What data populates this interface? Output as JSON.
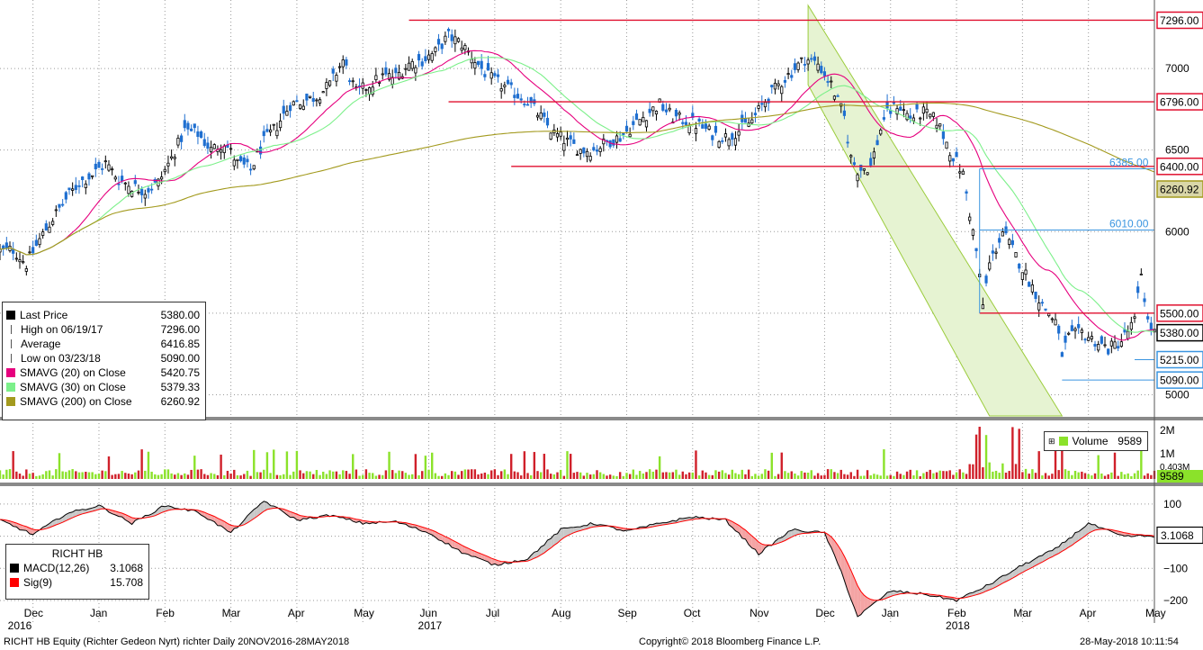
{
  "ticker": "RICHT HB",
  "price_legend": {
    "rows": [
      {
        "label": "Last Price",
        "value": "5380.00",
        "swatch": "#000000"
      },
      {
        "label": "High on 06/19/17",
        "value": "7296.00",
        "swatch": "none"
      },
      {
        "label": "Average",
        "value": "6416.85",
        "swatch": "none"
      },
      {
        "label": "Low on 03/23/18",
        "value": "5090.00",
        "swatch": "none"
      },
      {
        "label": "SMAVG (20) on Close",
        "value": "5420.75",
        "swatch": "#e6007e"
      },
      {
        "label": "SMAVG (30) on Close",
        "value": "5379.33",
        "swatch": "#7cf08a"
      },
      {
        "label": "SMAVG (200) on Close",
        "value": "6260.92",
        "swatch": "#a39a1e"
      }
    ]
  },
  "volume_legend": {
    "label": "Volume",
    "value": "9589"
  },
  "macd_legend": {
    "title": "RICHT HB",
    "rows": [
      {
        "label": "MACD(12,26)",
        "value": "3.1068",
        "swatch": "#000000"
      },
      {
        "label": "Sig(9)",
        "value": "15.708",
        "swatch": "#ff0000"
      }
    ]
  },
  "footer": {
    "left": "RICHT HB Equity (Richter Gedeon Nyrt) richter  Daily 20NOV2016-28MAY2018",
    "center": "Copyright© 2018 Bloomberg Finance L.P.",
    "right": "28-May-2018 10:11:54"
  },
  "colors": {
    "up": "#000000",
    "down": "#1f6fd0",
    "sma20": "#e6007e",
    "sma30": "#7cf08a",
    "sma200": "#a39a1e",
    "level": "#e0102f",
    "fib": "#3a95e0",
    "channel": "#9bcc3c",
    "macd": "#000000",
    "signal": "#ff0000"
  },
  "chart_data": [
    {
      "type": "candlestick",
      "x_months": [
        "Dec",
        "Jan",
        "Feb",
        "Mar",
        "Apr",
        "May",
        "Jun",
        "Jul",
        "Aug",
        "Sep",
        "Oct",
        "Nov",
        "Dec",
        "Jan",
        "Feb",
        "Mar",
        "Apr",
        "May"
      ],
      "years": [
        "2016",
        "2017",
        "2018"
      ],
      "y_ticks": [
        5000,
        5500,
        6000,
        6500,
        7000
      ],
      "ylim": [
        4870,
        7420
      ],
      "close_path": [
        [
          0,
          5880
        ],
        [
          4,
          5890
        ],
        [
          8,
          5800
        ],
        [
          12,
          5950
        ],
        [
          16,
          6080
        ],
        [
          20,
          6200
        ],
        [
          24,
          6300
        ],
        [
          28,
          6350
        ],
        [
          32,
          6420
        ],
        [
          36,
          6320
        ],
        [
          40,
          6280
        ],
        [
          44,
          6250
        ],
        [
          48,
          6300
        ],
        [
          52,
          6450
        ],
        [
          56,
          6620
        ],
        [
          60,
          6600
        ],
        [
          64,
          6500
        ],
        [
          68,
          6550
        ],
        [
          72,
          6420
        ],
        [
          76,
          6380
        ],
        [
          80,
          6550
        ],
        [
          84,
          6650
        ],
        [
          88,
          6780
        ],
        [
          92,
          6800
        ],
        [
          96,
          6830
        ],
        [
          100,
          6900
        ],
        [
          104,
          7050
        ],
        [
          108,
          6850
        ],
        [
          112,
          6900
        ],
        [
          116,
          6950
        ],
        [
          120,
          6950
        ],
        [
          124,
          7030
        ],
        [
          128,
          7050
        ],
        [
          132,
          7100
        ],
        [
          136,
          7200
        ],
        [
          140,
          7150
        ],
        [
          144,
          7050
        ],
        [
          148,
          6950
        ],
        [
          152,
          6900
        ],
        [
          156,
          6850
        ],
        [
          160,
          6800
        ],
        [
          164,
          6700
        ],
        [
          168,
          6600
        ],
        [
          172,
          6550
        ],
        [
          176,
          6500
        ],
        [
          180,
          6500
        ],
        [
          184,
          6550
        ],
        [
          188,
          6580
        ],
        [
          192,
          6650
        ],
        [
          196,
          6720
        ],
        [
          200,
          6780
        ],
        [
          204,
          6700
        ],
        [
          208,
          6680
        ],
        [
          212,
          6650
        ],
        [
          216,
          6600
        ],
        [
          220,
          6580
        ],
        [
          224,
          6620
        ],
        [
          228,
          6680
        ],
        [
          232,
          6800
        ],
        [
          236,
          6900
        ],
        [
          240,
          6980
        ],
        [
          244,
          7060
        ],
        [
          248,
          7030
        ],
        [
          252,
          6900
        ],
        [
          256,
          6700
        ],
        [
          258,
          6450
        ],
        [
          260,
          6380
        ],
        [
          264,
          6400
        ],
        [
          268,
          6700
        ],
        [
          272,
          6780
        ],
        [
          276,
          6700
        ],
        [
          280,
          6730
        ],
        [
          284,
          6680
        ],
        [
          288,
          6500
        ],
        [
          292,
          6350
        ],
        [
          296,
          5880
        ],
        [
          298,
          5550
        ],
        [
          300,
          5800
        ],
        [
          304,
          6000
        ],
        [
          308,
          5850
        ],
        [
          312,
          5700
        ],
        [
          316,
          5550
        ],
        [
          320,
          5450
        ],
        [
          322,
          5250
        ],
        [
          324,
          5350
        ],
        [
          328,
          5380
        ],
        [
          332,
          5330
        ],
        [
          336,
          5280
        ],
        [
          340,
          5330
        ],
        [
          344,
          5450
        ],
        [
          346,
          5750
        ],
        [
          348,
          5450
        ],
        [
          350,
          5380
        ]
      ],
      "series": [
        {
          "name": "SMAVG (20) on Close",
          "last": 5420.75
        },
        {
          "name": "SMAVG (30) on Close",
          "last": 5379.33
        },
        {
          "name": "SMAVG (200) on Close",
          "last": 6260.92
        }
      ],
      "price_labels": [
        {
          "text": "7296.00",
          "value": 7296,
          "kind": "level"
        },
        {
          "text": "6796.00",
          "value": 6796,
          "kind": "level"
        },
        {
          "text": "6400.00",
          "value": 6400,
          "kind": "level"
        },
        {
          "text": "6260.92",
          "value": 6260.92,
          "kind": "sma200"
        },
        {
          "text": "5500.00",
          "value": 5500,
          "kind": "level"
        },
        {
          "text": "5380.00",
          "value": 5380,
          "kind": "last"
        },
        {
          "text": "5215.00",
          "value": 5215,
          "kind": "fib"
        },
        {
          "text": "5090.00",
          "value": 5090,
          "kind": "fib"
        }
      ],
      "fib_labels": [
        {
          "text": "6385.00",
          "value": 6385
        },
        {
          "text": "6010.00",
          "value": 6010
        }
      ]
    },
    {
      "type": "bar",
      "title": "Volume",
      "y_ticks": [
        "2M",
        "1M",
        "0.403M"
      ],
      "last": "9589"
    },
    {
      "type": "line",
      "title": "MACD",
      "y_ticks": [
        100,
        0,
        -100,
        -200
      ],
      "ylim": [
        -270,
        150
      ],
      "path": [
        [
          0,
          50
        ],
        [
          10,
          5
        ],
        [
          20,
          70
        ],
        [
          30,
          95
        ],
        [
          40,
          40
        ],
        [
          50,
          95
        ],
        [
          60,
          75
        ],
        [
          70,
          10
        ],
        [
          80,
          110
        ],
        [
          90,
          50
        ],
        [
          100,
          65
        ],
        [
          110,
          40
        ],
        [
          120,
          45
        ],
        [
          130,
          10
        ],
        [
          140,
          -50
        ],
        [
          150,
          -90
        ],
        [
          160,
          -70
        ],
        [
          170,
          20
        ],
        [
          180,
          40
        ],
        [
          190,
          15
        ],
        [
          200,
          40
        ],
        [
          210,
          60
        ],
        [
          220,
          50
        ],
        [
          230,
          -55
        ],
        [
          240,
          20
        ],
        [
          250,
          10
        ],
        [
          255,
          -110
        ],
        [
          260,
          -250
        ],
        [
          270,
          -170
        ],
        [
          280,
          -180
        ],
        [
          290,
          -200
        ],
        [
          300,
          -150
        ],
        [
          310,
          -90
        ],
        [
          320,
          -40
        ],
        [
          330,
          40
        ],
        [
          340,
          0
        ]
      ],
      "series": [
        {
          "name": "MACD(12,26)",
          "last": 3.1068
        },
        {
          "name": "Sig(9)",
          "last": 15.708
        }
      ],
      "last_label": "3.1068"
    }
  ]
}
